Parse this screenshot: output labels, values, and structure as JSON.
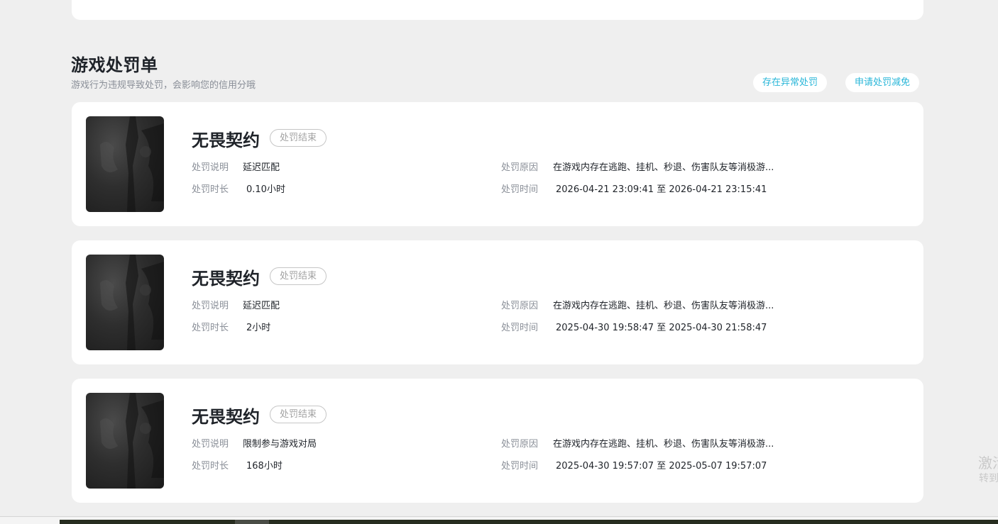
{
  "section": {
    "title": "游戏处罚单",
    "subtitle": "游戏行为违规导致处罚，会影响您的信用分哦"
  },
  "actions": {
    "abnormal_label": "存在异常处罚",
    "reduce_label": "申请处罚减免"
  },
  "labels": {
    "description": "处罚说明",
    "duration": "处罚时长",
    "reason": "处罚原因",
    "time": "处罚时间"
  },
  "records": [
    {
      "game": "无畏契约",
      "status": "处罚结束",
      "description": "延迟匹配",
      "duration": "0.10小时",
      "reason": "在游戏内存在逃跑、挂机、秒退、伤害队友等消极游...",
      "time": "2026-04-21 23:09:41 至 2026-04-21 23:15:41"
    },
    {
      "game": "无畏契约",
      "status": "处罚结束",
      "description": "延迟匹配",
      "duration": "2小时",
      "reason": "在游戏内存在逃跑、挂机、秒退、伤害队友等消极游...",
      "time": "2025-04-30 19:58:47 至 2025-04-30 21:58:47"
    },
    {
      "game": "无畏契约",
      "status": "处罚结束",
      "description": "限制参与游戏对局",
      "duration": "168小时",
      "reason": "在游戏内存在逃跑、挂机、秒退、伤害队友等消极游...",
      "time": "2025-04-30 19:57:07 至 2025-05-07 19:57:07"
    }
  ],
  "watermark": {
    "line1": "激活",
    "line2": "转到"
  },
  "icons": {
    "game_cover": "game-cover-image"
  },
  "colors": {
    "accent": "#28b6d8",
    "background": "#efefef",
    "card": "#ffffff"
  }
}
